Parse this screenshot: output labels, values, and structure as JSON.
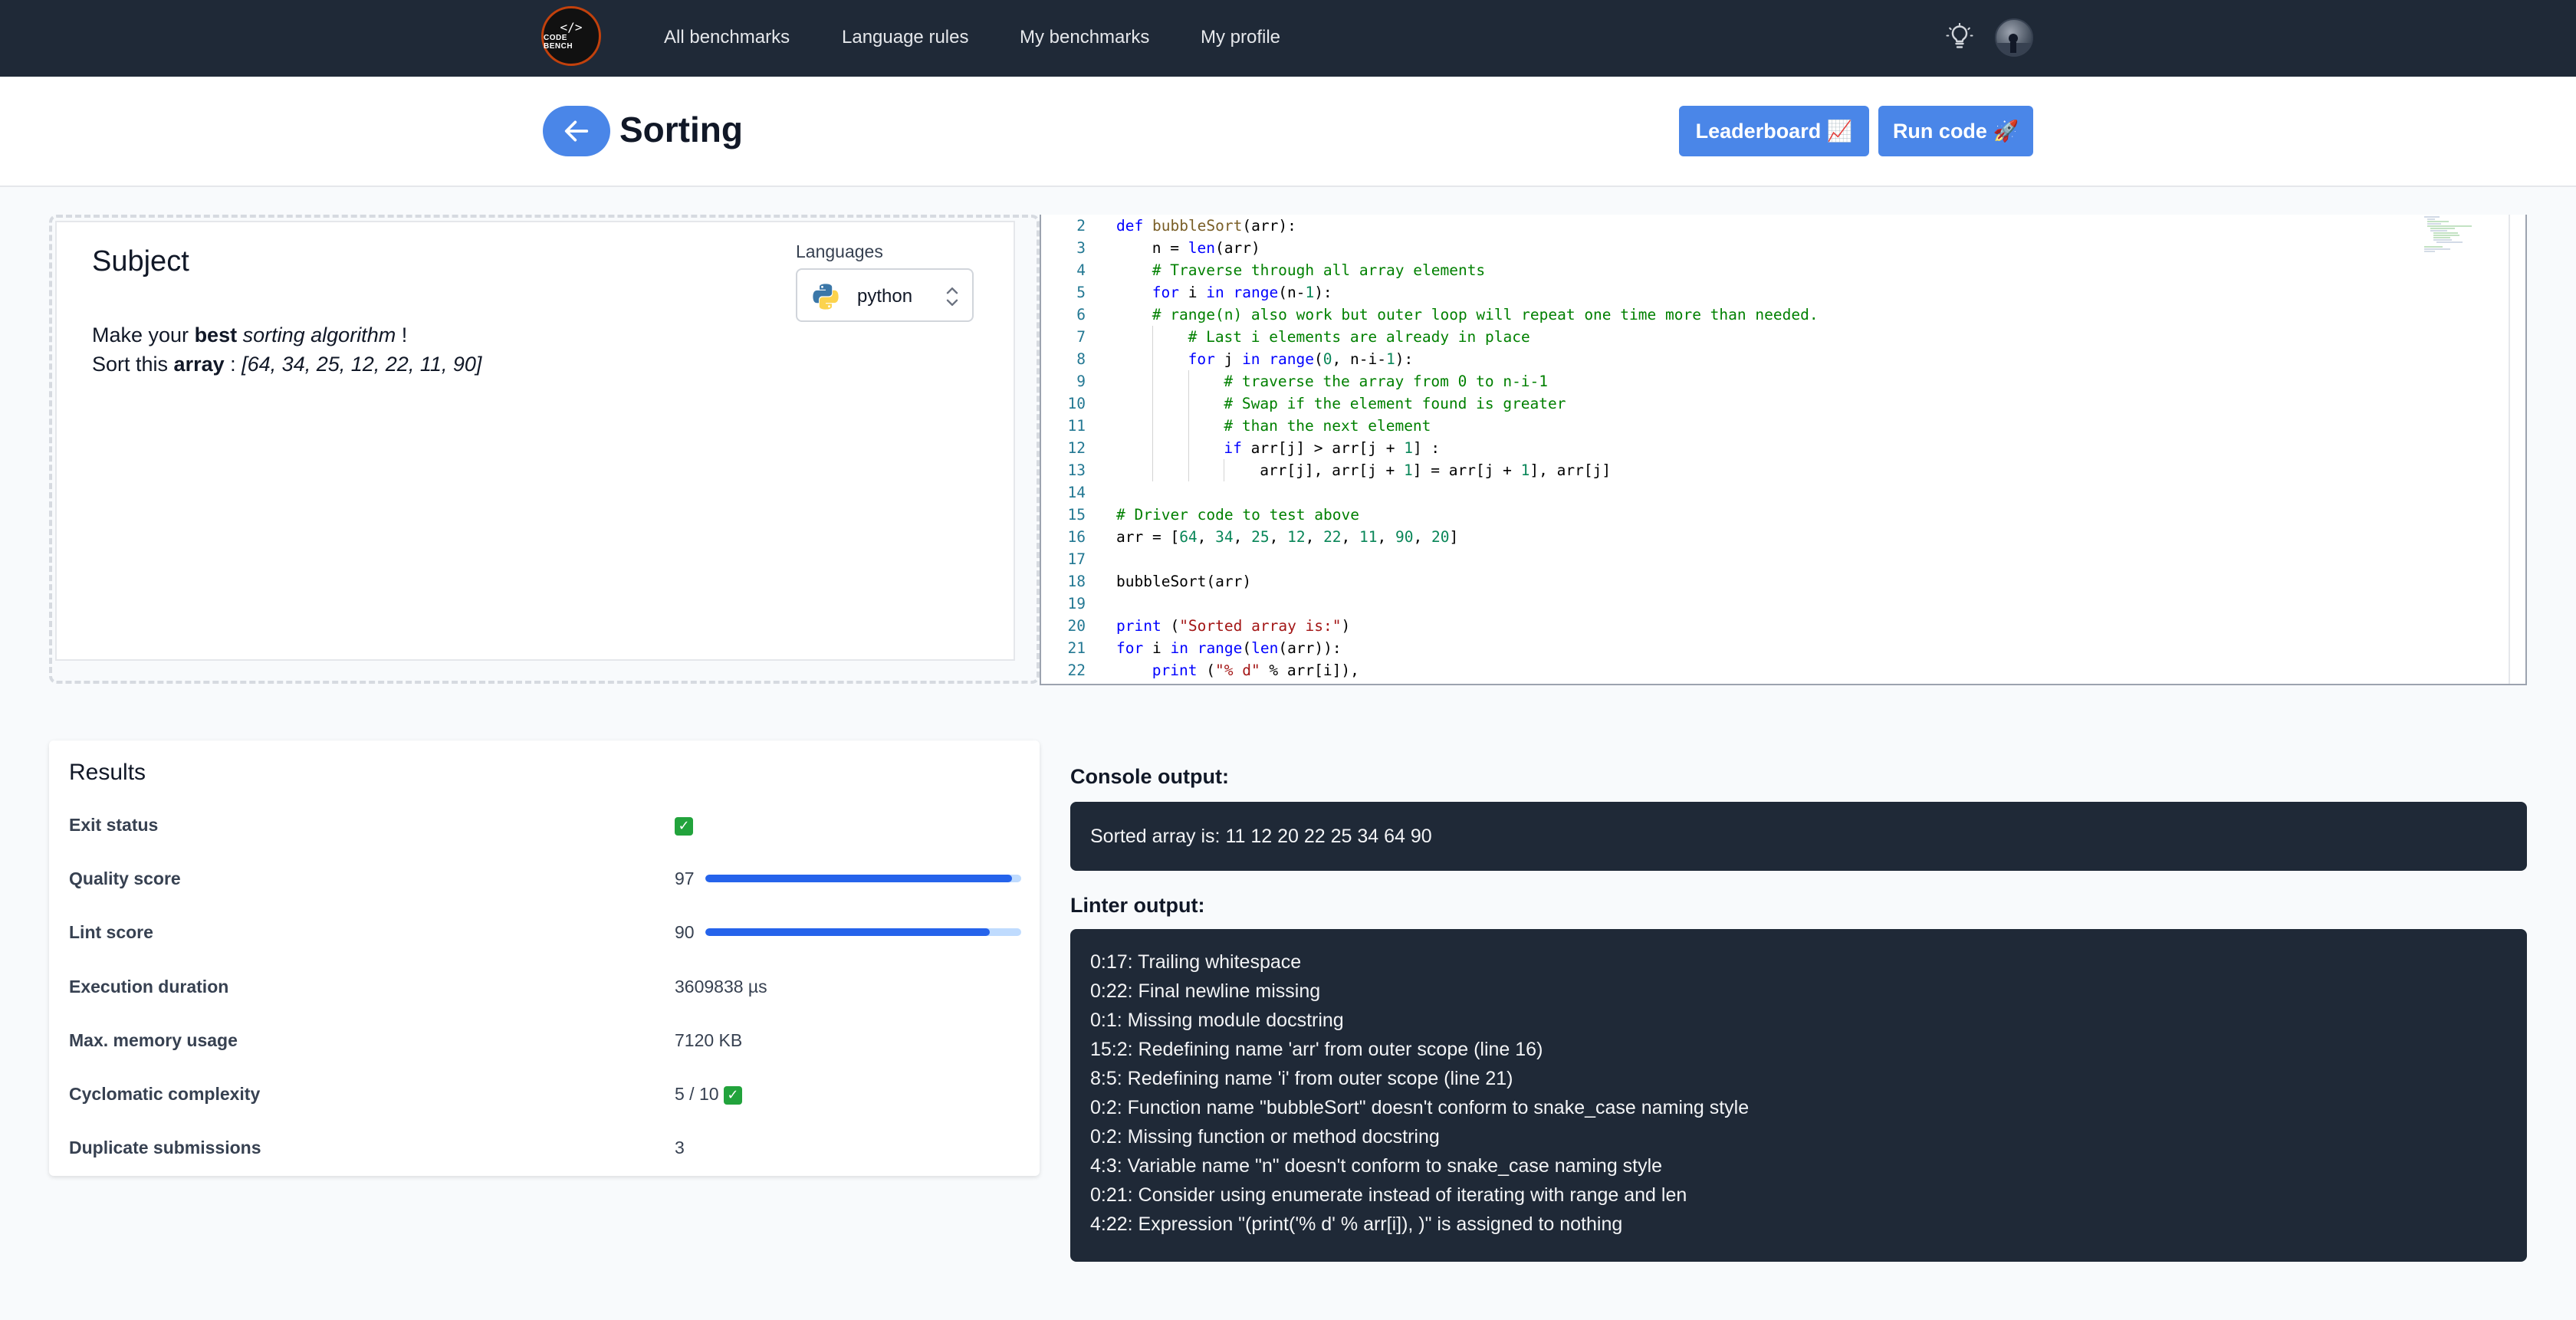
{
  "nav": {
    "logo_text": "CODE BENCH",
    "links": [
      "All benchmarks",
      "Language rules",
      "My benchmarks",
      "My profile"
    ],
    "theme_icon": "lightbulb-icon",
    "avatar_icon": "user-avatar"
  },
  "header": {
    "title": "Sorting",
    "back_icon": "arrow-left-icon",
    "leaderboard_label": "Leaderboard 📈",
    "run_label": "Run code 🚀"
  },
  "subject": {
    "title": "Subject",
    "line1": {
      "a": "Make your ",
      "b": "best",
      "c": " ",
      "d": "sorting algorithm",
      "e": " !"
    },
    "line2": {
      "a": "Sort this ",
      "b": "array",
      "c": " : ",
      "d": "[64, 34, 25, 12, 22, 11, 90]"
    },
    "languages_label": "Languages",
    "language_selected": "python"
  },
  "editor": {
    "lines": [
      {
        "n": "2",
        "indent": 0,
        "code": "def bubbleSort(arr):"
      },
      {
        "n": "3",
        "indent": 1,
        "code": "n = len(arr)"
      },
      {
        "n": "4",
        "indent": 1,
        "code": "# Traverse through all array elements"
      },
      {
        "n": "5",
        "indent": 1,
        "code": "for i in range(n-1):"
      },
      {
        "n": "6",
        "indent": 1,
        "code": "# range(n) also work but outer loop will repeat one time more than needed."
      },
      {
        "n": "7",
        "indent": 2,
        "code": "# Last i elements are already in place"
      },
      {
        "n": "8",
        "indent": 2,
        "code": "for j in range(0, n-i-1):"
      },
      {
        "n": "9",
        "indent": 3,
        "code": "# traverse the array from 0 to n-i-1"
      },
      {
        "n": "10",
        "indent": 3,
        "code": "# Swap if the element found is greater"
      },
      {
        "n": "11",
        "indent": 3,
        "code": "# than the next element"
      },
      {
        "n": "12",
        "indent": 3,
        "code": "if arr[j] > arr[j + 1] :"
      },
      {
        "n": "13",
        "indent": 4,
        "code": "arr[j], arr[j + 1] = arr[j + 1], arr[j]"
      },
      {
        "n": "14",
        "indent": 0,
        "code": ""
      },
      {
        "n": "15",
        "indent": 0,
        "code": "# Driver code to test above"
      },
      {
        "n": "16",
        "indent": 0,
        "code": "arr = [64, 34, 25, 12, 22, 11, 90, 20]"
      },
      {
        "n": "17",
        "indent": 0,
        "code": ""
      },
      {
        "n": "18",
        "indent": 0,
        "code": "bubbleSort(arr)"
      },
      {
        "n": "19",
        "indent": 0,
        "code": ""
      },
      {
        "n": "20",
        "indent": 0,
        "code": "print (\"Sorted array is:\")"
      },
      {
        "n": "21",
        "indent": 0,
        "code": "for i in range(len(arr)):"
      },
      {
        "n": "22",
        "indent": 1,
        "code": "print (\"% d\" % arr[i]),"
      }
    ]
  },
  "results": {
    "title": "Results",
    "rows": [
      {
        "label": "Exit status",
        "value": "",
        "check": true
      },
      {
        "label": "Quality score",
        "value": "97",
        "progress": 0.97
      },
      {
        "label": "Lint score",
        "value": "90",
        "progress": 0.9
      },
      {
        "label": "Execution duration",
        "value": "3609838 µs"
      },
      {
        "label": "Max. memory usage",
        "value": "7120 KB"
      },
      {
        "label": "Cyclomatic complexity",
        "value": "5 / 10",
        "check": true
      },
      {
        "label": "Duplicate submissions",
        "value": "3"
      }
    ]
  },
  "console": {
    "label": "Console output:",
    "text": "Sorted array is: 11 12 20 22 25 34 64 90"
  },
  "linter": {
    "label": "Linter output:",
    "lines": [
      "0:17: Trailing whitespace",
      "0:22: Final newline missing",
      "0:1: Missing module docstring",
      "15:2: Redefining name 'arr' from outer scope (line 16)",
      "8:5: Redefining name 'i' from outer scope (line 21)",
      "0:2: Function name \"bubbleSort\" doesn't conform to snake_case naming style",
      "0:2: Missing function or method docstring",
      "4:3: Variable name \"n\" doesn't conform to snake_case naming style",
      "0:21: Consider using enumerate instead of iterating with range and len",
      "4:22: Expression \"(print('% d' % arr[i]), )\" is assigned to nothing"
    ]
  },
  "colors": {
    "nav_bg": "#1f2937",
    "accent": "#4a86e8",
    "progress": "#2563eb",
    "output_bg": "#1f2937"
  }
}
